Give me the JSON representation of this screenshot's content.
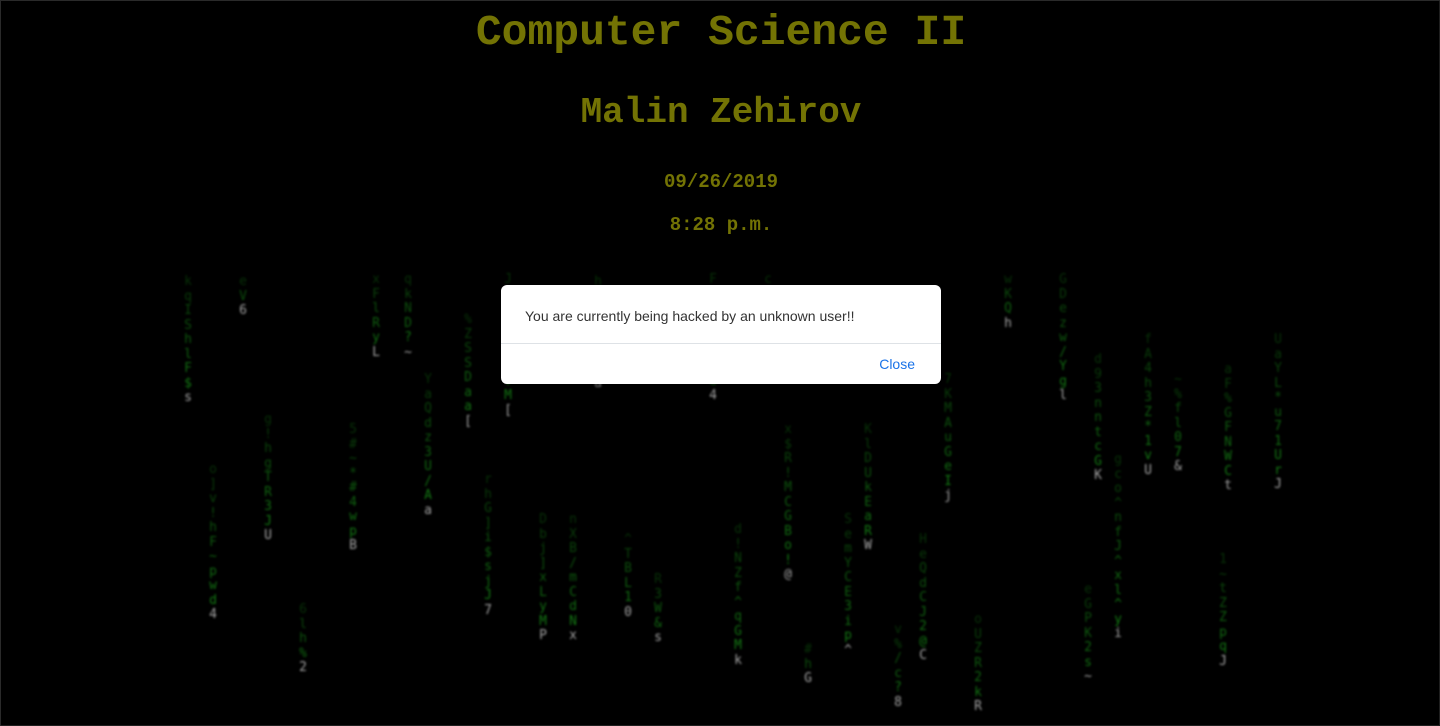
{
  "theme": {
    "accent": "#9a9a06",
    "rain_color": "#1fb81f",
    "background": "#000000"
  },
  "header": {
    "course_title": "Computer Science II",
    "student_name": "Malin Zehirov",
    "date": "09/26/2019",
    "time": "8:28 p.m."
  },
  "modal": {
    "message": "You are currently being hacked by an unknown user!!",
    "close_label": "Close"
  }
}
